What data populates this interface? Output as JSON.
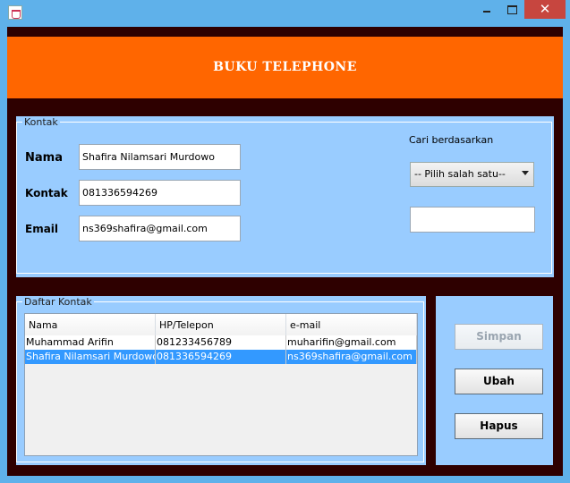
{
  "window": {
    "title": "",
    "close_glyph": "✕"
  },
  "header": {
    "title": "BUKU TELEPHONE"
  },
  "contact": {
    "legend": "Kontak",
    "nama_label": "Nama",
    "kontak_label": "Kontak",
    "email_label": "Email",
    "nama_value": "Shafira Nilamsari Murdowo",
    "kontak_value": "081336594269",
    "email_value": "ns369shafira@gmail.com"
  },
  "search": {
    "label": "Cari berdasarkan",
    "combo_selected": "-- Pilih salah satu--",
    "query_value": ""
  },
  "list": {
    "legend": "Daftar Kontak",
    "columns": [
      "Nama",
      "HP/Telepon",
      "e-mail"
    ],
    "rows": [
      [
        "Muhammad Arifin",
        "081233456789",
        "muharifin@gmail.com"
      ],
      [
        "Shafira Nilamsari Murdowo",
        "081336594269",
        "ns369shafira@gmail.com"
      ]
    ],
    "selected_row": 1
  },
  "actions": {
    "simpan": "Simpan",
    "ubah": "Ubah",
    "hapus": "Hapus"
  },
  "colors": {
    "header_bg": "#ff6600",
    "panel_bg": "#99ccff",
    "frame_bg": "#2e0000",
    "selection": "#3399ff"
  }
}
